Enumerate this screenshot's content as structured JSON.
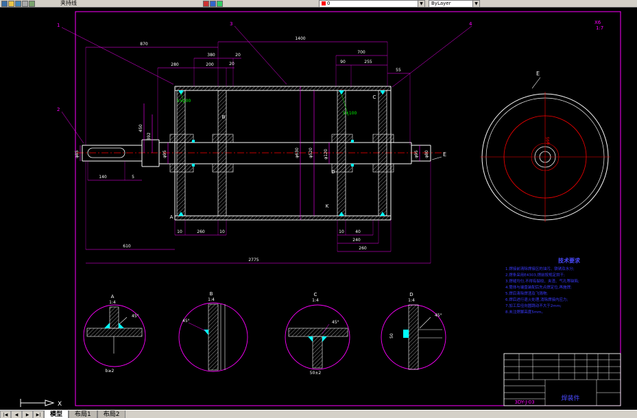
{
  "toolbar": {
    "label": "夹持线",
    "layer_value": "0",
    "color_value": "ByLayer"
  },
  "tabs": {
    "nav": [
      "|◀",
      "◀",
      "▶",
      "▶|"
    ],
    "items": [
      {
        "label": "模型"
      },
      {
        "label": "布局1"
      },
      {
        "label": "布局2"
      }
    ]
  },
  "ucs": {
    "x_label": "X"
  },
  "corner_note": {
    "line1": "X6",
    "line2": "1:7"
  },
  "balloons": [
    "1",
    "2",
    "3",
    "4"
  ],
  "section_labels": {
    "e_top": "E",
    "e_side": "E",
    "k": "K"
  },
  "view_letters": {
    "a": "A",
    "b": "B",
    "c": "C",
    "d": "D"
  },
  "dims": {
    "t870": "870",
    "t1400": "1400",
    "t380": "380",
    "t20a": "20",
    "t280": "280",
    "t200": "200",
    "t20b": "20",
    "t700": "700",
    "t90": "90",
    "t255": "255",
    "t55": "55",
    "v450": "450",
    "v392": "392",
    "b140": "140",
    "b5": "5",
    "b10a": "10",
    "b260": "260",
    "b10b": "10",
    "b10c": "10",
    "b40": "40",
    "b240": "240",
    "b260r": "260",
    "b610": "610",
    "b2775": "2775",
    "dia85": "φ85",
    "dia95": "φ95",
    "dia630": "φ630",
    "dia520": "φ520",
    "dia120": "φ120",
    "dia95r": "φ95",
    "dia80": "φ80",
    "end_dia": "φ95",
    "det_d_50": "50"
  },
  "weld_callouts": {
    "w1": "5×100",
    "w2": "5×100"
  },
  "details": [
    {
      "label": "A",
      "scale": "1:4",
      "angle": "45°",
      "note": "b≥2"
    },
    {
      "label": "B",
      "scale": "1:4",
      "angle": "45°",
      "note": ""
    },
    {
      "label": "C",
      "scale": "1:4",
      "angle": "45°",
      "note": "50±2"
    },
    {
      "label": "D",
      "scale": "1:4",
      "angle": "45°",
      "note": ""
    }
  ],
  "notes": {
    "title": "技术要求",
    "lines": [
      "1.焊接前清除焊接区的油污、铁锈及水分;",
      "2.焊条采用E4303,焊前按规定烘干;",
      "3.焊缝均匀,不得有裂纹、夹渣、气孔等缺陷;",
      "4.筒体与端盘装配后先点焊定位,再施焊;",
      "5.焊后清除焊渣及飞溅物;",
      "6.焊后进行退火处理,消除焊接内应力;",
      "7.加工后径向圆跳动不大于2mm;",
      "8.未注焊脚高度5mm。"
    ]
  },
  "title_block": {
    "part_name": "焊装件",
    "drawing_no": "3DY-J-03"
  }
}
